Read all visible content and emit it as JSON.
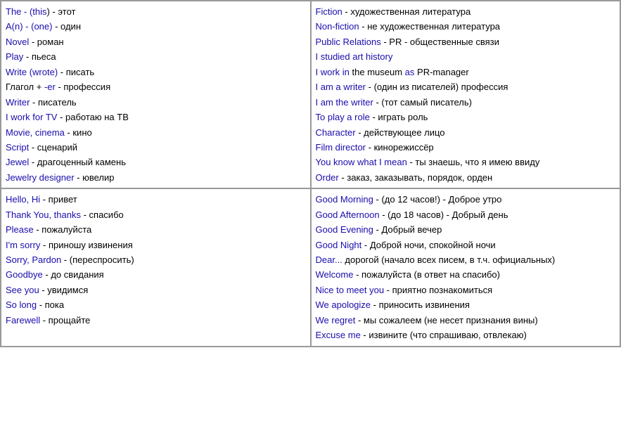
{
  "cells": [
    {
      "id": "top-left",
      "lines": [
        {
          "parts": [
            {
              "text": "The - (this) - этот",
              "blue": [
                "The",
                "this"
              ],
              "red": [],
              "black": true
            }
          ]
        },
        {
          "parts": [
            {
              "text": "A(n) - (one) - один",
              "blue": [
                "A(n)",
                "one"
              ],
              "red": [],
              "black": true
            }
          ]
        },
        {
          "parts": [
            {
              "text": "Novel - роман",
              "blue": [
                "Novel"
              ],
              "red": [],
              "black": true
            }
          ]
        },
        {
          "parts": [
            {
              "text": "Play - пьеса",
              "blue": [
                "Play"
              ],
              "red": [],
              "black": true
            }
          ]
        },
        {
          "parts": [
            {
              "text": "Write (wrote) - писать",
              "blue": [
                "Write",
                "wrote"
              ],
              "red": [],
              "black": true
            }
          ]
        },
        {
          "parts": [
            {
              "text": "Глагол + -er - профессия",
              "blue": [],
              "red": [],
              "black": true
            }
          ]
        },
        {
          "parts": [
            {
              "text": "Writer - писатель",
              "blue": [
                "Writer"
              ],
              "red": [],
              "black": true
            }
          ]
        },
        {
          "parts": [
            {
              "text": "I work for TV - работаю на ТВ",
              "blue": [
                "I work for TV"
              ],
              "red": [],
              "black": true
            }
          ]
        },
        {
          "parts": [
            {
              "text": "Movie, cinema - кино",
              "blue": [
                "Movie, cinema"
              ],
              "red": [],
              "black": true
            }
          ]
        },
        {
          "parts": [
            {
              "text": "Script - сценарий",
              "blue": [
                "Script"
              ],
              "red": [],
              "black": true
            }
          ]
        },
        {
          "parts": [
            {
              "text": "Jewel - драгоценный камень",
              "blue": [
                "Jewel"
              ],
              "red": [],
              "black": true
            }
          ]
        },
        {
          "parts": [
            {
              "text": "Jewelry designer - ювелир",
              "blue": [
                "Jewelry designer"
              ],
              "red": [],
              "black": true
            }
          ]
        }
      ]
    },
    {
      "id": "top-right",
      "lines": [
        {
          "parts": [
            {
              "text": "Fiction - художественная литература",
              "blue": [
                "Fiction"
              ],
              "red": [],
              "black": true
            }
          ]
        },
        {
          "parts": [
            {
              "text": "Non-fiction - не художественная литература",
              "blue": [
                "Non-fiction"
              ],
              "red": [],
              "black": true
            }
          ]
        },
        {
          "parts": [
            {
              "text": "Public Relations - PR - общественные связи",
              "blue": [
                "Public Relations"
              ],
              "red": [],
              "black": true
            }
          ]
        },
        {
          "parts": [
            {
              "text": "I studied art history",
              "blue": [
                "I studied art history"
              ],
              "red": [],
              "black": false
            }
          ]
        },
        {
          "parts": [
            {
              "text": "I work in the museum as PR-manager",
              "blue": [
                "I work in",
                "as"
              ],
              "red": [],
              "black": true,
              "mixed": true
            }
          ]
        },
        {
          "parts": [
            {
              "text": "I am a writer - (один из писателей) профессия",
              "blue": [
                "I am a writer"
              ],
              "red": [],
              "black": true
            }
          ]
        },
        {
          "parts": [
            {
              "text": "I am the writer - (тот самый писатель)",
              "blue": [
                "I am the writer"
              ],
              "red": [],
              "black": true
            }
          ]
        },
        {
          "parts": [
            {
              "text": "To play a role - играть роль",
              "blue": [
                "To play a role"
              ],
              "red": [],
              "black": true
            }
          ]
        },
        {
          "parts": [
            {
              "text": "Character - действующее лицо",
              "blue": [
                "Character"
              ],
              "red": [],
              "black": true
            }
          ]
        },
        {
          "parts": [
            {
              "text": "Film director - кинорежиссёр",
              "blue": [
                "Film director"
              ],
              "red": [],
              "black": true
            }
          ]
        },
        {
          "parts": [
            {
              "text": "You know what I mean - ты знаешь, что я имею ввиду",
              "blue": [
                "You know what I mean"
              ],
              "red": [],
              "black": true
            }
          ]
        },
        {
          "parts": [
            {
              "text": "Order - заказ, заказывать, порядок, орден",
              "blue": [
                "Order"
              ],
              "red": [],
              "black": true
            }
          ]
        }
      ]
    },
    {
      "id": "bottom-left",
      "lines": [
        {
          "parts": [
            {
              "text": "Hello, Hi - привет",
              "blue": [
                "Hello, Hi"
              ],
              "red": [],
              "black": true
            }
          ]
        },
        {
          "parts": [
            {
              "text": "Thank You, thanks - спасибо",
              "blue": [
                "Thank You, thanks"
              ],
              "red": [],
              "black": true
            }
          ]
        },
        {
          "parts": [
            {
              "text": "Please - пожалуйста",
              "blue": [
                "Please"
              ],
              "red": [],
              "black": true
            }
          ]
        },
        {
          "parts": [
            {
              "text": "I'm sorry - приношу извинения",
              "blue": [
                "I'm sorry"
              ],
              "red": [],
              "black": true
            }
          ]
        },
        {
          "parts": [
            {
              "text": "Sorry, Pardon - (переспросить)",
              "blue": [
                "Sorry, Pardon"
              ],
              "red": [],
              "black": true
            }
          ]
        },
        {
          "parts": [
            {
              "text": "Goodbye - до свидания",
              "blue": [
                "Goodbye"
              ],
              "red": [],
              "black": true
            }
          ]
        },
        {
          "parts": [
            {
              "text": "See you - увидимся",
              "blue": [
                "See you"
              ],
              "red": [],
              "black": true
            }
          ]
        },
        {
          "parts": [
            {
              "text": "So long - пока",
              "blue": [
                "So long"
              ],
              "red": [],
              "black": true
            }
          ]
        },
        {
          "parts": [
            {
              "text": "Farewell - прощайте",
              "blue": [
                "Farewell"
              ],
              "red": [],
              "black": true
            }
          ]
        }
      ]
    },
    {
      "id": "bottom-right",
      "lines": [
        {
          "parts": [
            {
              "text": "Good Morning - (до 12 часов!) - Доброе утро",
              "blue": [
                "Good Morning"
              ],
              "red": [],
              "black": true
            }
          ]
        },
        {
          "parts": [
            {
              "text": "Good Afternoon - (до 18 часов) - Добрый день",
              "blue": [
                "Good Afternoon"
              ],
              "red": [],
              "black": true
            }
          ]
        },
        {
          "parts": [
            {
              "text": "Good Evening - Добрый вечер",
              "blue": [
                "Good Evening"
              ],
              "red": [],
              "black": true
            }
          ]
        },
        {
          "parts": [
            {
              "text": "Good Night - Доброй ночи, спокойной ночи",
              "blue": [
                "Good Night"
              ],
              "red": [],
              "black": true
            }
          ]
        },
        {
          "parts": [
            {
              "text": "Dear... дорогой (начало всех писем, в т.ч. официальных)",
              "blue": [],
              "red": [],
              "black": true,
              "dearmixed": true
            }
          ]
        },
        {
          "parts": [
            {
              "text": "Welcome - пожалуйста (в ответ на спасибо)",
              "blue": [
                "Welcome"
              ],
              "red": [],
              "black": true
            }
          ]
        },
        {
          "parts": [
            {
              "text": "Nice to meet you - приятно познакомиться",
              "blue": [
                "Nice to meet you"
              ],
              "red": [],
              "black": true
            }
          ]
        },
        {
          "parts": [
            {
              "text": "We apologize - приносить извинения",
              "blue": [
                "We apologize"
              ],
              "red": [],
              "black": true
            }
          ]
        },
        {
          "parts": [
            {
              "text": "We regret - мы сожалеем (не несет признания вины)",
              "blue": [
                "We regret"
              ],
              "red": [],
              "black": true
            }
          ]
        },
        {
          "parts": [
            {
              "text": "Excuse me - извините (что спрашиваю, отвлекаю)",
              "blue": [
                "Excuse me"
              ],
              "red": [],
              "black": true
            }
          ]
        }
      ]
    }
  ]
}
